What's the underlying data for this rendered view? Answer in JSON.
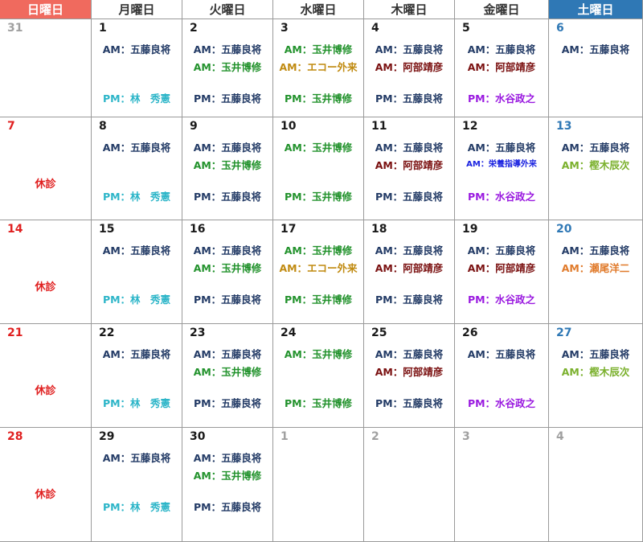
{
  "weekdays": [
    "日曜日",
    "月曜日",
    "火曜日",
    "水曜日",
    "木曜日",
    "金曜日",
    "土曜日"
  ],
  "holiday_label": "休診",
  "colors": {
    "sunday_header": "#f06a5e",
    "saturday_header": "#2f78b5",
    "sunday_text": "#e02020",
    "saturday_text": "#2f78b5"
  },
  "weeks": [
    {
      "days": [
        {
          "n": "31",
          "other": true,
          "lines": []
        },
        {
          "n": "1",
          "lines": [
            {
              "t": "AM：五藤良将",
              "c": "navy",
              "slot": 1
            },
            {
              "t": "PM：林　秀憲",
              "c": "cyan",
              "slot": 3
            }
          ]
        },
        {
          "n": "2",
          "lines": [
            {
              "t": "AM：五藤良将",
              "c": "navy",
              "slot": 1
            },
            {
              "t": "AM：玉井博修",
              "c": "green",
              "slot": 2
            },
            {
              "t": "PM：五藤良将",
              "c": "navy",
              "slot": 3
            }
          ]
        },
        {
          "n": "3",
          "lines": [
            {
              "t": "AM：玉井博修",
              "c": "green",
              "slot": 1
            },
            {
              "t": "AM：エコー外来",
              "c": "gold",
              "slot": 2
            },
            {
              "t": "PM：玉井博修",
              "c": "green",
              "slot": 3
            }
          ]
        },
        {
          "n": "4",
          "lines": [
            {
              "t": "AM：五藤良将",
              "c": "navy",
              "slot": 1
            },
            {
              "t": "AM：阿部靖彦",
              "c": "maroon",
              "slot": 2
            },
            {
              "t": "PM：五藤良将",
              "c": "navy",
              "slot": 3
            }
          ]
        },
        {
          "n": "5",
          "lines": [
            {
              "t": "AM：五藤良将",
              "c": "navy",
              "slot": 1
            },
            {
              "t": "AM：阿部靖彦",
              "c": "maroon",
              "slot": 2
            },
            {
              "t": "PM：水谷政之",
              "c": "purple",
              "slot": 3
            }
          ]
        },
        {
          "n": "6",
          "lines": [
            {
              "t": "AM：五藤良将",
              "c": "navy",
              "slot": 1
            }
          ]
        }
      ]
    },
    {
      "days": [
        {
          "n": "7",
          "holiday": true,
          "lines": []
        },
        {
          "n": "8",
          "lines": [
            {
              "t": "AM：五藤良将",
              "c": "navy",
              "slot": 1
            },
            {
              "t": "PM：林　秀憲",
              "c": "cyan",
              "slot": 3
            }
          ]
        },
        {
          "n": "9",
          "lines": [
            {
              "t": "AM：五藤良将",
              "c": "navy",
              "slot": 1
            },
            {
              "t": "AM：玉井博修",
              "c": "green",
              "slot": 2
            },
            {
              "t": "PM：五藤良将",
              "c": "navy",
              "slot": 3
            }
          ]
        },
        {
          "n": "10",
          "lines": [
            {
              "t": "AM：玉井博修",
              "c": "green",
              "slot": 1
            },
            {
              "t": "PM：玉井博修",
              "c": "green",
              "slot": 3
            }
          ]
        },
        {
          "n": "11",
          "lines": [
            {
              "t": "AM：五藤良将",
              "c": "navy",
              "slot": 1
            },
            {
              "t": "AM：阿部靖彦",
              "c": "maroon",
              "slot": 2
            },
            {
              "t": "PM：五藤良将",
              "c": "navy",
              "slot": 3
            }
          ]
        },
        {
          "n": "12",
          "lines": [
            {
              "t": "AM：五藤良将",
              "c": "navy",
              "slot": 1
            },
            {
              "t": "AM：栄養指導外来",
              "c": "blue",
              "slot": 2,
              "small": true
            },
            {
              "t": "PM：水谷政之",
              "c": "purple",
              "slot": 3
            }
          ]
        },
        {
          "n": "13",
          "lines": [
            {
              "t": "AM：五藤良将",
              "c": "navy",
              "slot": 1
            },
            {
              "t": "AM：樫木辰次",
              "c": "olive",
              "slot": 2
            }
          ]
        }
      ]
    },
    {
      "days": [
        {
          "n": "14",
          "holiday": true,
          "lines": []
        },
        {
          "n": "15",
          "lines": [
            {
              "t": "AM：五藤良将",
              "c": "navy",
              "slot": 1
            },
            {
              "t": "PM：林　秀憲",
              "c": "cyan",
              "slot": 3
            }
          ]
        },
        {
          "n": "16",
          "lines": [
            {
              "t": "AM：五藤良将",
              "c": "navy",
              "slot": 1
            },
            {
              "t": "AM：玉井博修",
              "c": "green",
              "slot": 2
            },
            {
              "t": "PM：五藤良将",
              "c": "navy",
              "slot": 3
            }
          ]
        },
        {
          "n": "17",
          "lines": [
            {
              "t": "AM：玉井博修",
              "c": "green",
              "slot": 1
            },
            {
              "t": "AM：エコー外来",
              "c": "gold",
              "slot": 2
            },
            {
              "t": "PM：玉井博修",
              "c": "green",
              "slot": 3
            }
          ]
        },
        {
          "n": "18",
          "lines": [
            {
              "t": "AM：五藤良将",
              "c": "navy",
              "slot": 1
            },
            {
              "t": "AM：阿部靖彦",
              "c": "maroon",
              "slot": 2
            },
            {
              "t": "PM：五藤良将",
              "c": "navy",
              "slot": 3
            }
          ]
        },
        {
          "n": "19",
          "lines": [
            {
              "t": "AM：五藤良将",
              "c": "navy",
              "slot": 1
            },
            {
              "t": "AM：阿部靖彦",
              "c": "maroon",
              "slot": 2
            },
            {
              "t": "PM：水谷政之",
              "c": "purple",
              "slot": 3
            }
          ]
        },
        {
          "n": "20",
          "lines": [
            {
              "t": "AM：五藤良将",
              "c": "navy",
              "slot": 1
            },
            {
              "t": "AM：瀬尾洋二",
              "c": "orange",
              "slot": 2
            }
          ]
        }
      ]
    },
    {
      "days": [
        {
          "n": "21",
          "holiday": true,
          "lines": []
        },
        {
          "n": "22",
          "lines": [
            {
              "t": "AM：五藤良将",
              "c": "navy",
              "slot": 1
            },
            {
              "t": "PM：林　秀憲",
              "c": "cyan",
              "slot": 3
            }
          ]
        },
        {
          "n": "23",
          "lines": [
            {
              "t": "AM：五藤良将",
              "c": "navy",
              "slot": 1
            },
            {
              "t": "AM：玉井博修",
              "c": "green",
              "slot": 2
            },
            {
              "t": "PM：五藤良将",
              "c": "navy",
              "slot": 3
            }
          ]
        },
        {
          "n": "24",
          "lines": [
            {
              "t": "AM：玉井博修",
              "c": "green",
              "slot": 1
            },
            {
              "t": "PM：玉井博修",
              "c": "green",
              "slot": 3
            }
          ]
        },
        {
          "n": "25",
          "lines": [
            {
              "t": "AM：五藤良将",
              "c": "navy",
              "slot": 1
            },
            {
              "t": "AM：阿部靖彦",
              "c": "maroon",
              "slot": 2
            },
            {
              "t": "PM：五藤良将",
              "c": "navy",
              "slot": 3
            }
          ]
        },
        {
          "n": "26",
          "lines": [
            {
              "t": "AM：五藤良将",
              "c": "navy",
              "slot": 1
            },
            {
              "t": "PM：水谷政之",
              "c": "purple",
              "slot": 3
            }
          ]
        },
        {
          "n": "27",
          "lines": [
            {
              "t": "AM：五藤良将",
              "c": "navy",
              "slot": 1
            },
            {
              "t": "AM：樫木辰次",
              "c": "olive",
              "slot": 2
            }
          ]
        }
      ]
    },
    {
      "days": [
        {
          "n": "28",
          "holiday": true,
          "lines": []
        },
        {
          "n": "29",
          "lines": [
            {
              "t": "AM：五藤良将",
              "c": "navy",
              "slot": 1
            },
            {
              "t": "PM：林　秀憲",
              "c": "cyan",
              "slot": 3
            }
          ]
        },
        {
          "n": "30",
          "lines": [
            {
              "t": "AM：五藤良将",
              "c": "navy",
              "slot": 1
            },
            {
              "t": "AM：玉井博修",
              "c": "green",
              "slot": 2
            },
            {
              "t": "PM：五藤良将",
              "c": "navy",
              "slot": 3
            }
          ]
        },
        {
          "n": "1",
          "other": true,
          "lines": []
        },
        {
          "n": "2",
          "other": true,
          "lines": []
        },
        {
          "n": "3",
          "other": true,
          "lines": []
        },
        {
          "n": "4",
          "other": true,
          "lines": []
        }
      ]
    }
  ]
}
